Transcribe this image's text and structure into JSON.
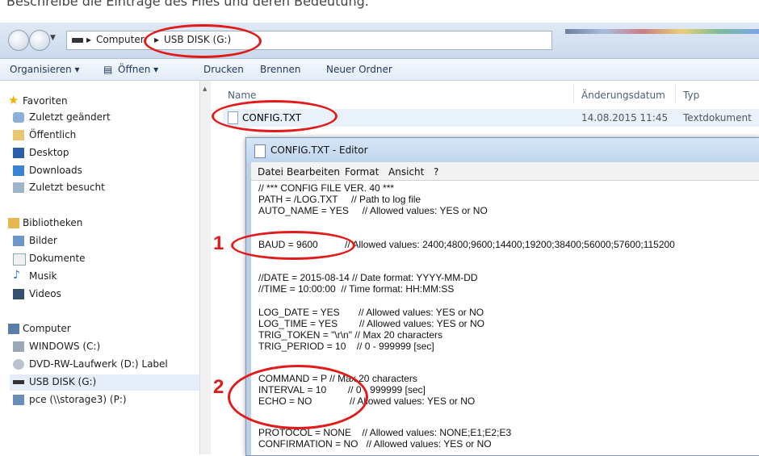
{
  "caption": "Beschreibe die Einträge des Files und deren Bedeutung.",
  "breadcrumb": {
    "root": "Computer",
    "current": "USB DISK (G:)"
  },
  "toolbar": {
    "organize": "Organisieren ▾",
    "open": "Öffnen ▾",
    "print": "Drucken",
    "burn": "Brennen",
    "new_folder": "Neuer Ordner"
  },
  "sidebar": {
    "favorites": "Favoriten",
    "fav_items": [
      "Zuletzt geändert",
      "Öffentlich",
      "Desktop",
      "Downloads",
      "Zuletzt besucht"
    ],
    "libraries": "Bibliotheken",
    "lib_items": [
      "Bilder",
      "Dokumente",
      "Musik",
      "Videos"
    ],
    "computer": "Computer",
    "comp_items": [
      "WINDOWS (C:)",
      "DVD-RW-Laufwerk (D:) Label",
      "USB DISK (G:)",
      "pce (\\\\storage3) (P:)"
    ]
  },
  "file_list": {
    "columns": {
      "name": "Name",
      "date": "Änderungsdatum",
      "type": "Typ"
    },
    "rows": [
      {
        "name": "CONFIG.TXT",
        "date": "14.08.2015 11:45",
        "type": "Textdokument"
      }
    ]
  },
  "editor": {
    "title": "CONFIG.TXT - Editor",
    "menu": [
      "Datei",
      "Bearbeiten",
      "Format",
      "Ansicht",
      "?"
    ],
    "lines": [
      "// *** CONFIG FILE VER. 40 ***",
      "PATH = /LOG.TXT     // Path to log file",
      "AUTO_NAME = YES     // Allowed values: YES or NO",
      "BAUD = 9600          // Allowed values: 2400;4800;9600;14400;19200;38400;56000;57600;115200",
      "//DATE = 2015-08-14 // Date format: YYYY-MM-DD",
      "//TIME = 10:00:00  // Time format: HH:MM:SS",
      "LOG_DATE = YES       // Allowed values: YES or NO",
      "LOG_TIME = YES        // Allowed values: YES or NO",
      "TRIG_TOKEN = \"\\r\\n\" // Max 20 characters",
      "TRIG_PERIOD = 10    // 0 - 999999 [sec]",
      "COMMAND = P // Max 20 characters",
      "INTERVAL = 10        // 0 - 999999 [sec]",
      "ECHO = NO              // Allowed values: YES or NO",
      "PROTOCOL = NONE    // Allowed values: NONE;E1;E2;E3",
      "CONFIRMATION = NO   // Allowed values: YES or NO"
    ]
  },
  "annotations": {
    "one": "1",
    "two": "2"
  },
  "colors": {
    "annotation": "#e21a1a",
    "selection": "#e5eef8"
  }
}
